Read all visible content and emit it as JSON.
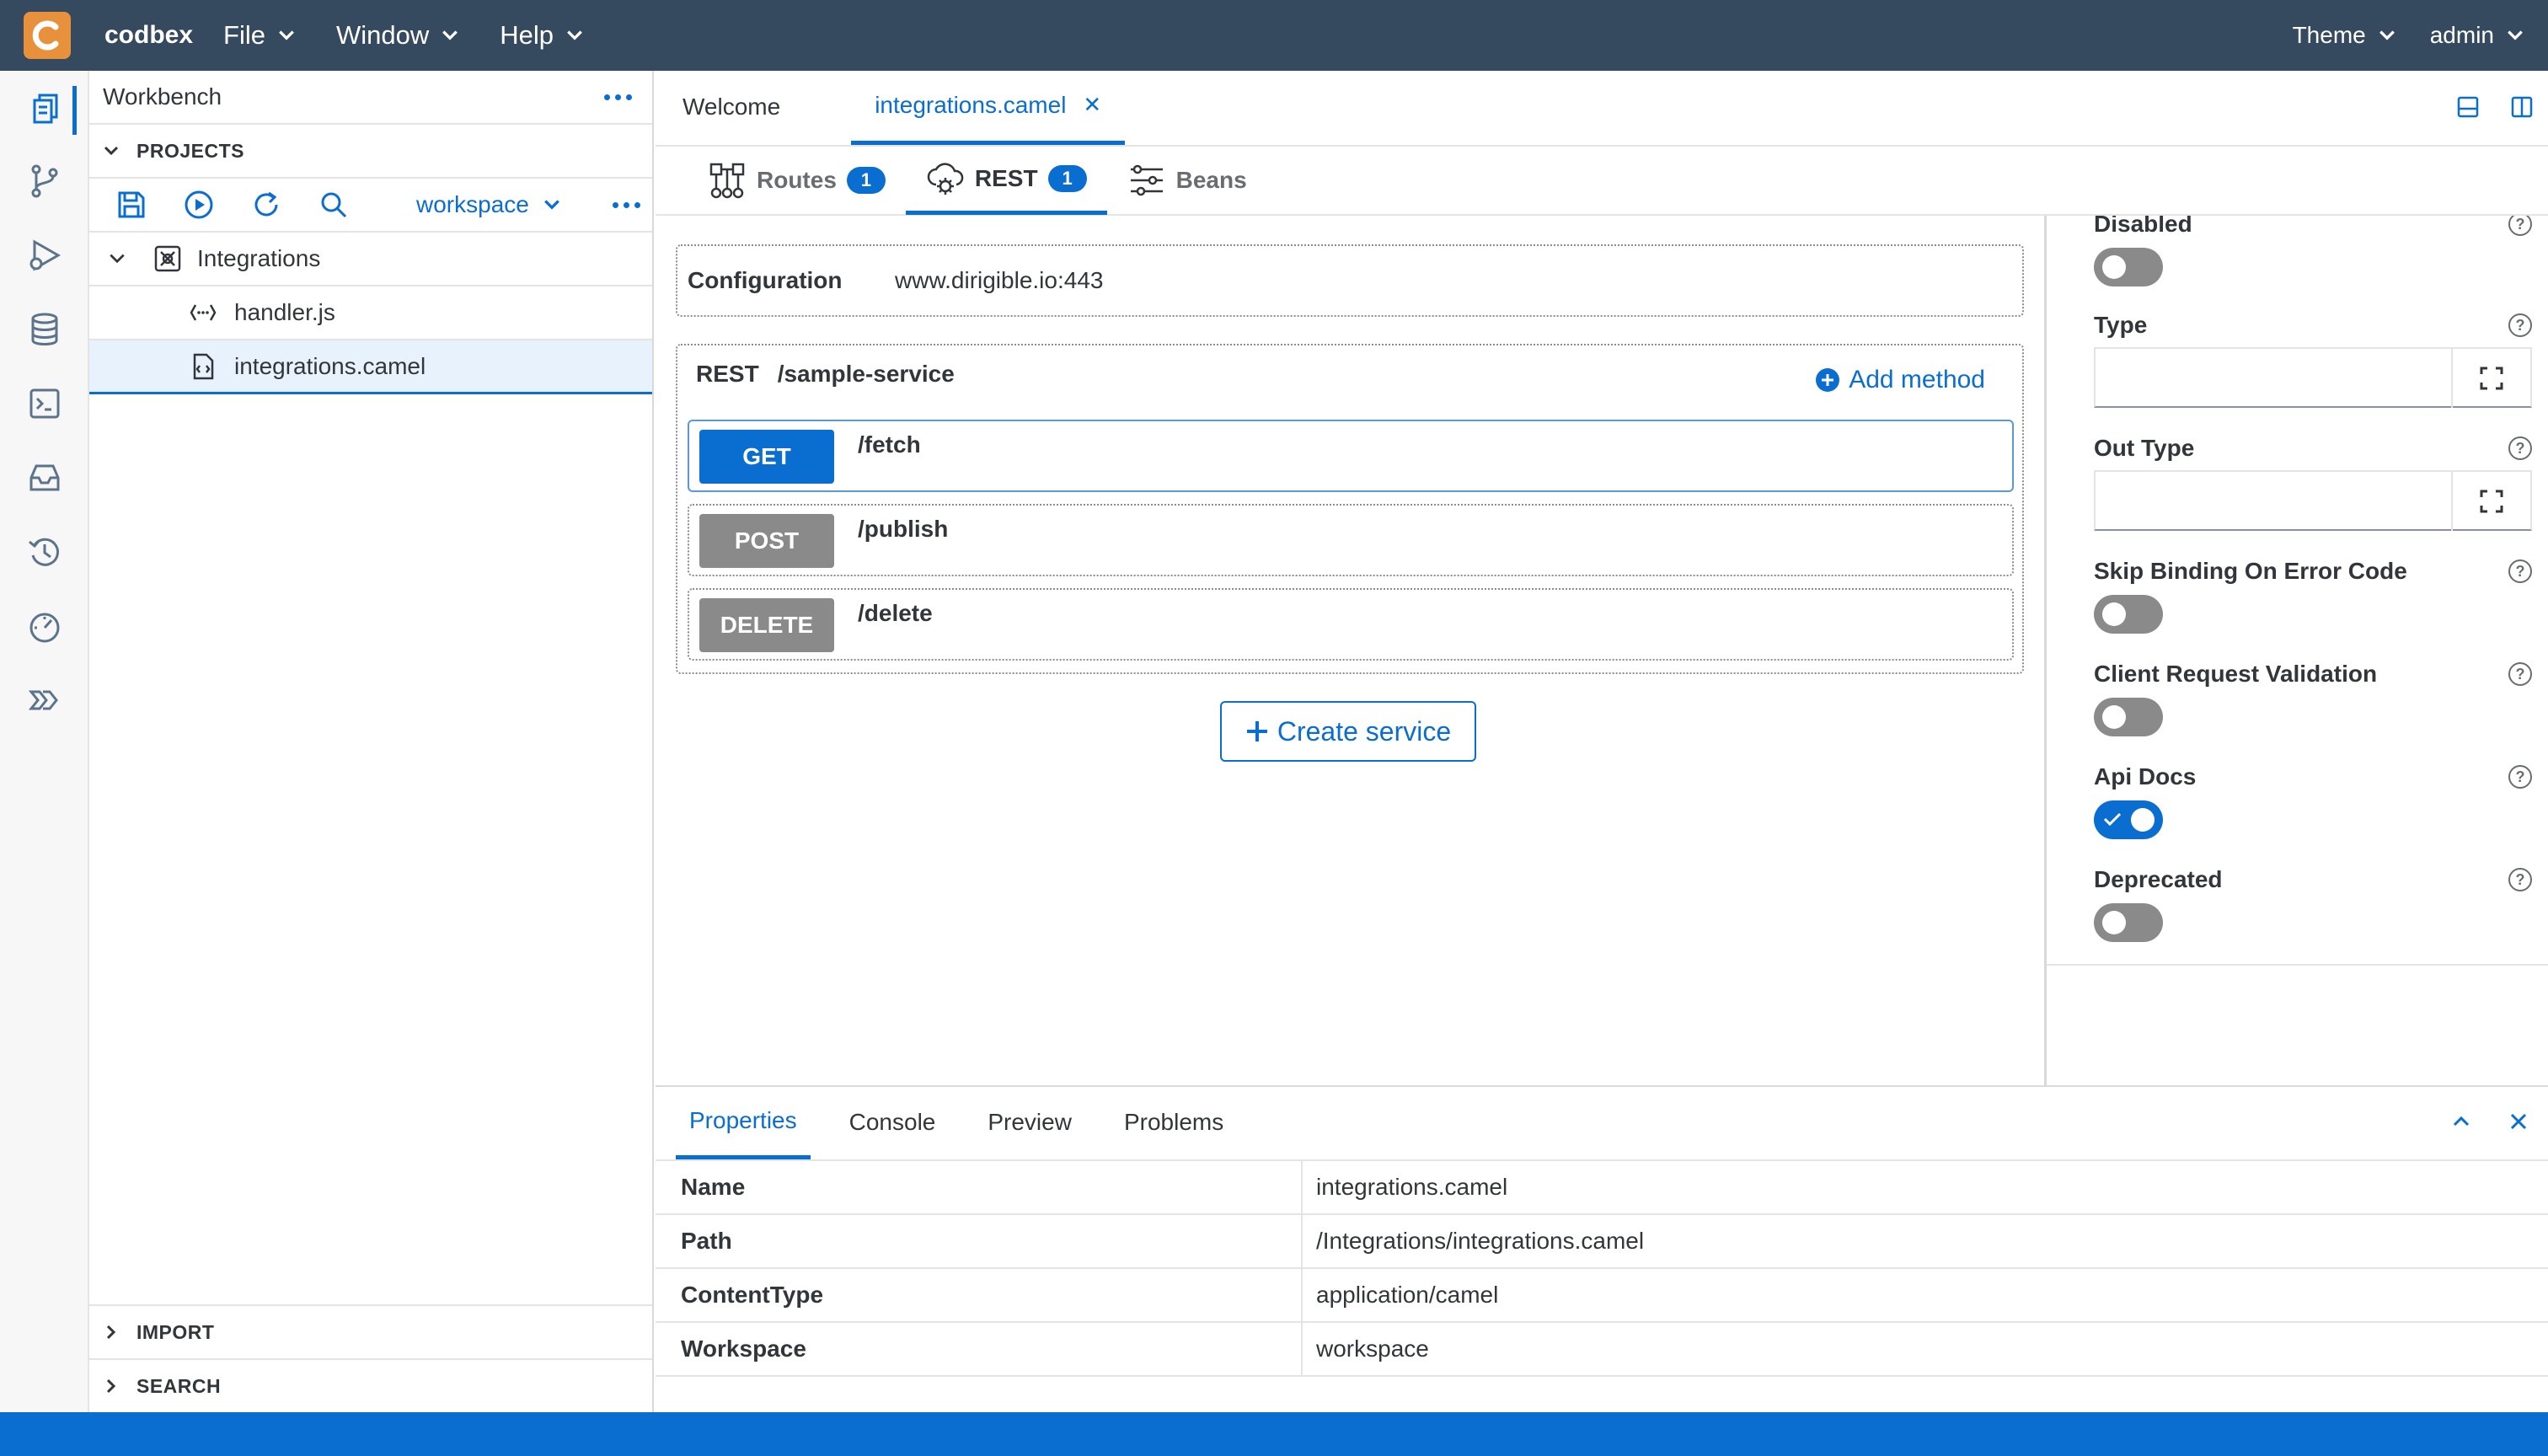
{
  "header": {
    "brand": "codbex",
    "menus": [
      {
        "label": "File"
      },
      {
        "label": "Window"
      },
      {
        "label": "Help"
      }
    ],
    "theme_label": "Theme",
    "user_label": "admin"
  },
  "explorer": {
    "title": "Workbench",
    "projects_label": "PROJECTS",
    "workspace": "workspace",
    "tree": {
      "project": "Integrations",
      "files": [
        "handler.js",
        "integrations.camel"
      ]
    },
    "import_label": "IMPORT",
    "search_label": "SEARCH"
  },
  "editor": {
    "tabs": [
      {
        "label": "Welcome"
      },
      {
        "label": "integrations.camel"
      }
    ],
    "subtabs": [
      {
        "label": "Routes",
        "count": "1"
      },
      {
        "label": "REST",
        "count": "1"
      },
      {
        "label": "Beans"
      }
    ],
    "configuration": {
      "label": "Configuration",
      "value": "www.dirigible.io:443"
    },
    "rest": {
      "keyword": "REST",
      "path": "/sample-service",
      "add_method_label": "Add method",
      "methods": [
        {
          "verb": "GET",
          "path": "/fetch",
          "color": "#0a6ed1"
        },
        {
          "verb": "POST",
          "path": "/publish",
          "color": "#8a8a8a"
        },
        {
          "verb": "DELETE",
          "path": "/delete",
          "color": "#8a8a8a"
        }
      ]
    },
    "create_service_label": "Create service"
  },
  "properties_panel": {
    "disabled": {
      "label": "Disabled",
      "on": false
    },
    "type": {
      "label": "Type",
      "value": ""
    },
    "out_type": {
      "label": "Out Type",
      "value": ""
    },
    "skip_binding": {
      "label": "Skip Binding On Error Code",
      "on": false
    },
    "client_request_validation": {
      "label": "Client Request Validation",
      "on": false
    },
    "api_docs": {
      "label": "Api Docs",
      "on": true
    },
    "deprecated": {
      "label": "Deprecated",
      "on": false
    },
    "help_glyph": "?"
  },
  "bottom_panel": {
    "tabs": [
      {
        "label": "Properties"
      },
      {
        "label": "Console"
      },
      {
        "label": "Preview"
      },
      {
        "label": "Problems"
      }
    ],
    "rows": [
      {
        "key": "Name",
        "value": "integrations.camel"
      },
      {
        "key": "Path",
        "value": "/Integrations/integrations.camel"
      },
      {
        "key": "ContentType",
        "value": "application/camel"
      },
      {
        "key": "Workspace",
        "value": "workspace"
      }
    ]
  },
  "colors": {
    "accent": "#0a6ed1",
    "header_bg": "#354a5f",
    "logo": "#e8913c",
    "inactive_method": "#8a8a8a"
  }
}
